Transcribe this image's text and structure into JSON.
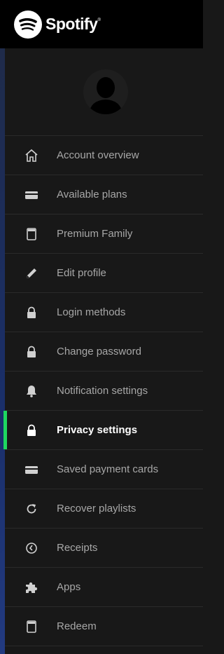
{
  "brand": {
    "name": "Spotify",
    "trademark": "®"
  },
  "profile": {
    "avatar": "default-user-avatar"
  },
  "menu": {
    "active_index": 7,
    "items": [
      {
        "label": "Account overview",
        "icon": "home-icon"
      },
      {
        "label": "Available plans",
        "icon": "card-icon"
      },
      {
        "label": "Premium Family",
        "icon": "tablet-icon"
      },
      {
        "label": "Edit profile",
        "icon": "pencil-icon"
      },
      {
        "label": "Login methods",
        "icon": "lock-icon"
      },
      {
        "label": "Change password",
        "icon": "lock-icon"
      },
      {
        "label": "Notification settings",
        "icon": "bell-icon"
      },
      {
        "label": "Privacy settings",
        "icon": "lock-icon"
      },
      {
        "label": "Saved payment cards",
        "icon": "card-icon"
      },
      {
        "label": "Recover playlists",
        "icon": "refresh-icon"
      },
      {
        "label": "Receipts",
        "icon": "clock-icon"
      },
      {
        "label": "Apps",
        "icon": "puzzle-icon"
      },
      {
        "label": "Redeem",
        "icon": "tablet-icon"
      }
    ]
  },
  "colors": {
    "background": "#181818",
    "topbar": "#000000",
    "text_inactive": "#a7a7a7",
    "text_active": "#ffffff",
    "accent": "#1ed760",
    "divider": "#2a2a2a"
  }
}
